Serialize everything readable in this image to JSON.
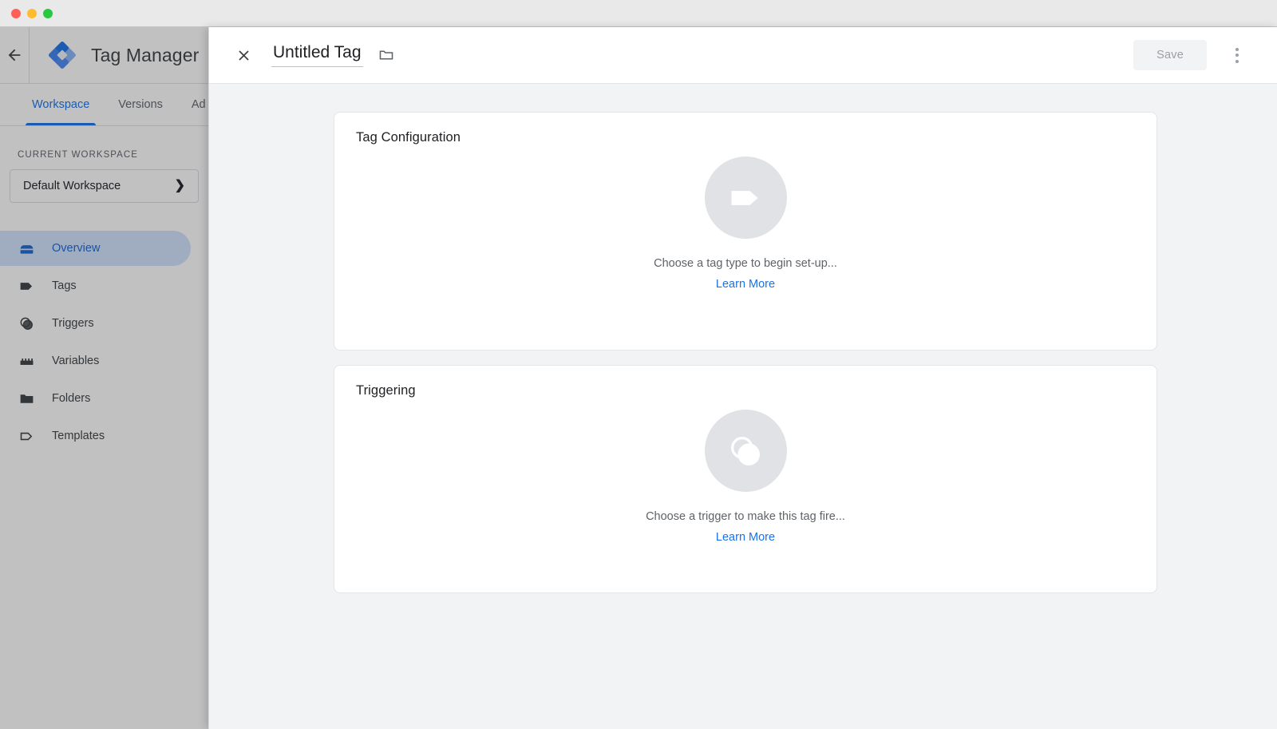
{
  "window": {
    "traffic_lights": [
      "close",
      "minimize",
      "maximize"
    ]
  },
  "app": {
    "back_icon": "arrow-left-icon",
    "logo_icon": "tag-manager-logo",
    "title": "Tag Manager",
    "tabs": [
      {
        "label": "Workspace",
        "active": true
      },
      {
        "label": "Versions",
        "active": false
      },
      {
        "label": "Ad",
        "active": false
      }
    ],
    "sidebar": {
      "section_label": "CURRENT WORKSPACE",
      "workspace": {
        "name": "Default Workspace",
        "chevron": "chevron-right-icon"
      },
      "items": [
        {
          "label": "Overview",
          "icon": "overview-icon",
          "active": true
        },
        {
          "label": "Tags",
          "icon": "tag-icon",
          "active": false
        },
        {
          "label": "Triggers",
          "icon": "trigger-icon",
          "active": false
        },
        {
          "label": "Variables",
          "icon": "variables-icon",
          "active": false
        },
        {
          "label": "Folders",
          "icon": "folder-icon",
          "active": false
        },
        {
          "label": "Templates",
          "icon": "template-icon",
          "active": false
        }
      ]
    }
  },
  "modal": {
    "close_icon": "close-icon",
    "tag_name": "Untitled Tag",
    "tag_name_placeholder": "Untitled Tag",
    "folder_icon": "folder-icon",
    "save_label": "Save",
    "save_enabled": false,
    "kebab_icon": "more-vert-icon",
    "cards": [
      {
        "title": "Tag Configuration",
        "icon": "tag-icon",
        "caption": "Choose a tag type to begin set-up...",
        "link_label": "Learn More"
      },
      {
        "title": "Triggering",
        "icon": "trigger-icon",
        "caption": "Choose a trigger to make this tag fire...",
        "link_label": "Learn More"
      }
    ]
  },
  "colors": {
    "accent_blue": "#1a73e8",
    "active_nav_bg": "#d2e3fc",
    "active_nav_fg": "#1967d2",
    "body_bg": "#f1f3f4",
    "card_bg": "#ffffff",
    "empty_circle": "#e0e2e5",
    "muted_text": "#5f6368",
    "title_bar": "#e9e9e9"
  }
}
